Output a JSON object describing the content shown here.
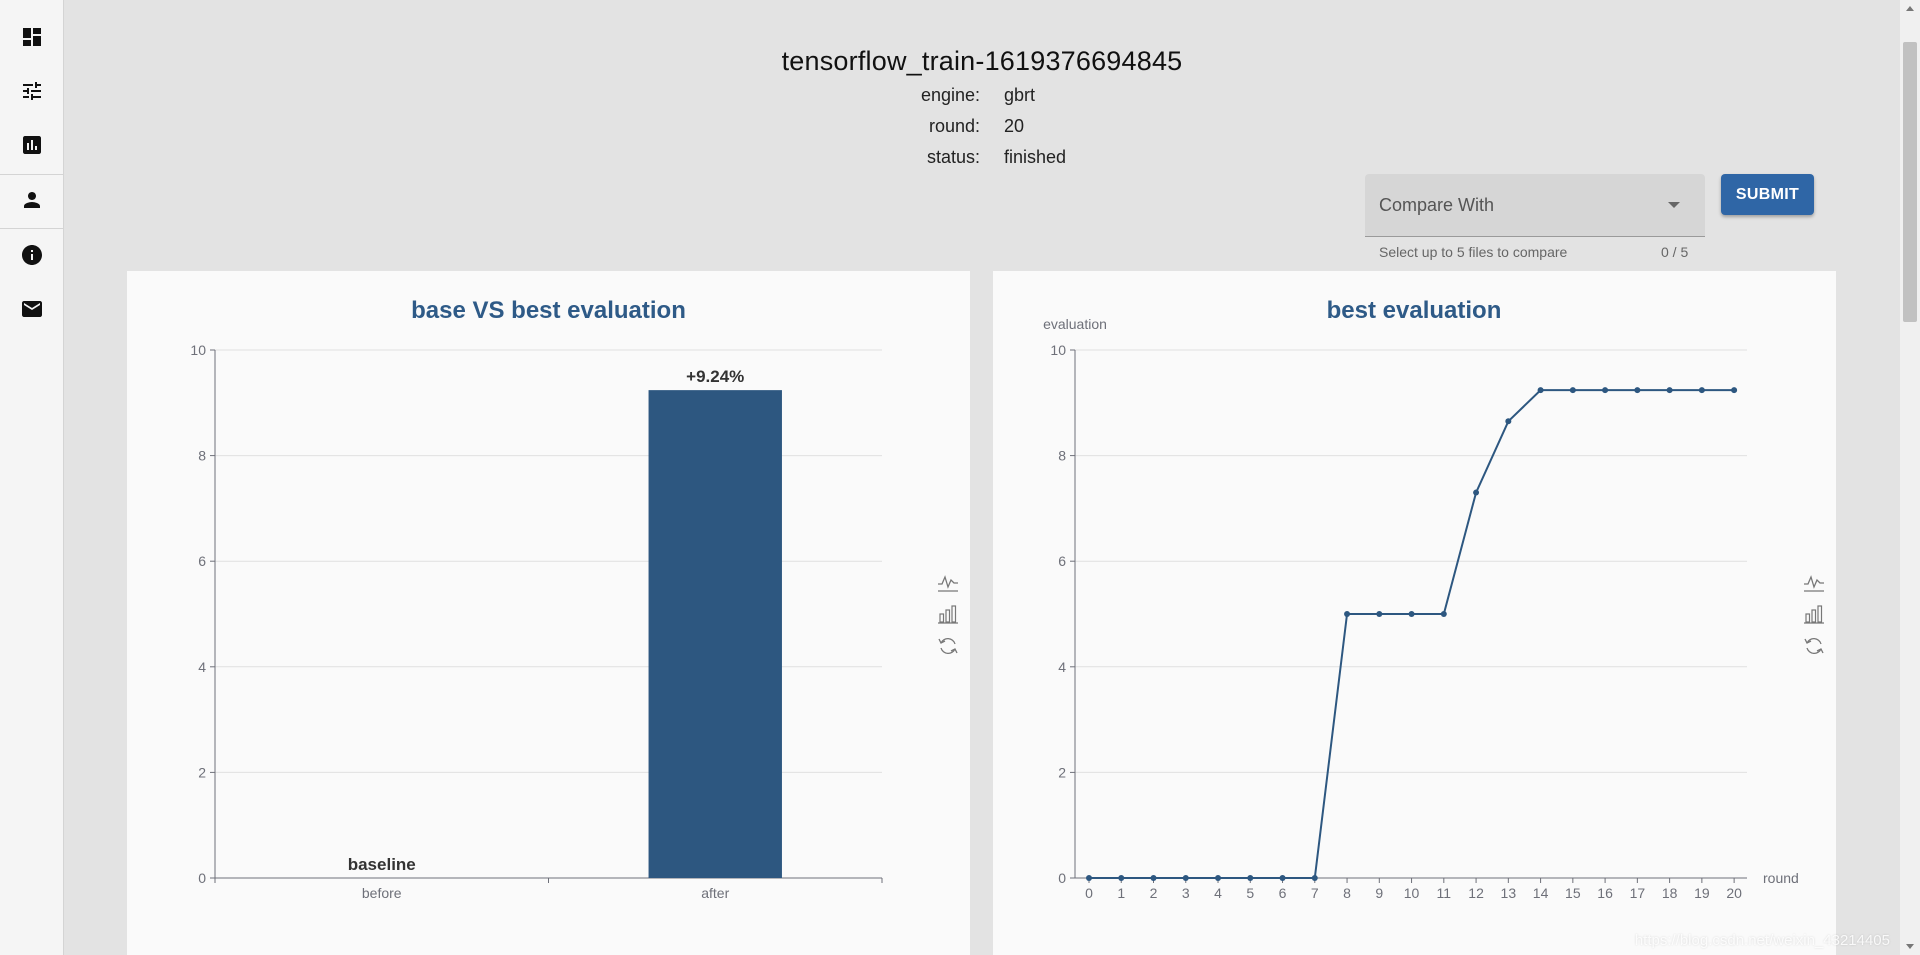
{
  "header": {
    "title": "tensorflow_train-1619376694845",
    "meta": [
      {
        "key": "engine:",
        "value": "gbrt"
      },
      {
        "key": "round:",
        "value": "20"
      },
      {
        "key": "status:",
        "value": "finished"
      }
    ]
  },
  "compare": {
    "label": "Compare With",
    "hint": "Select up to 5 files to compare",
    "count": "0 / 5"
  },
  "submit_label": "SUBMIT",
  "sidebar": {
    "items": [
      {
        "icon": "dashboard-icon"
      },
      {
        "icon": "tune-icon"
      },
      {
        "icon": "assessment-icon"
      },
      {
        "icon": "person-icon"
      },
      {
        "icon": "info-icon"
      },
      {
        "icon": "mail-icon"
      }
    ]
  },
  "toolbox": {
    "icons": [
      "line-chart-icon",
      "bar-chart-icon",
      "restore-icon"
    ]
  },
  "watermark": "https://blog.csdn.net/weixin_43214405",
  "colors": {
    "series": "#2d5780",
    "title": "#2e5a87",
    "submit": "#2f66a6"
  },
  "chart_data": [
    {
      "type": "bar",
      "title": "base VS best evaluation",
      "categories": [
        "before",
        "after"
      ],
      "values": [
        0,
        9.24
      ],
      "data_labels": [
        "baseline",
        "+9.24%"
      ],
      "ylim": [
        0,
        10
      ],
      "yticks": [
        0,
        2,
        4,
        6,
        8,
        10
      ],
      "xlabel": "",
      "ylabel": "",
      "grid": true
    },
    {
      "type": "line",
      "title": "best evaluation",
      "xlabel": "round",
      "ylabel": "evaluation",
      "x": [
        0,
        1,
        2,
        3,
        4,
        5,
        6,
        7,
        8,
        9,
        10,
        11,
        12,
        13,
        14,
        15,
        16,
        17,
        18,
        19,
        20
      ],
      "values": [
        0,
        0,
        0,
        0,
        0,
        0,
        0,
        0,
        5,
        5,
        5,
        5,
        7.3,
        8.65,
        9.24,
        9.24,
        9.24,
        9.24,
        9.24,
        9.24,
        9.24
      ],
      "ylim": [
        0,
        10
      ],
      "yticks": [
        0,
        2,
        4,
        6,
        8,
        10
      ],
      "grid": true
    }
  ]
}
